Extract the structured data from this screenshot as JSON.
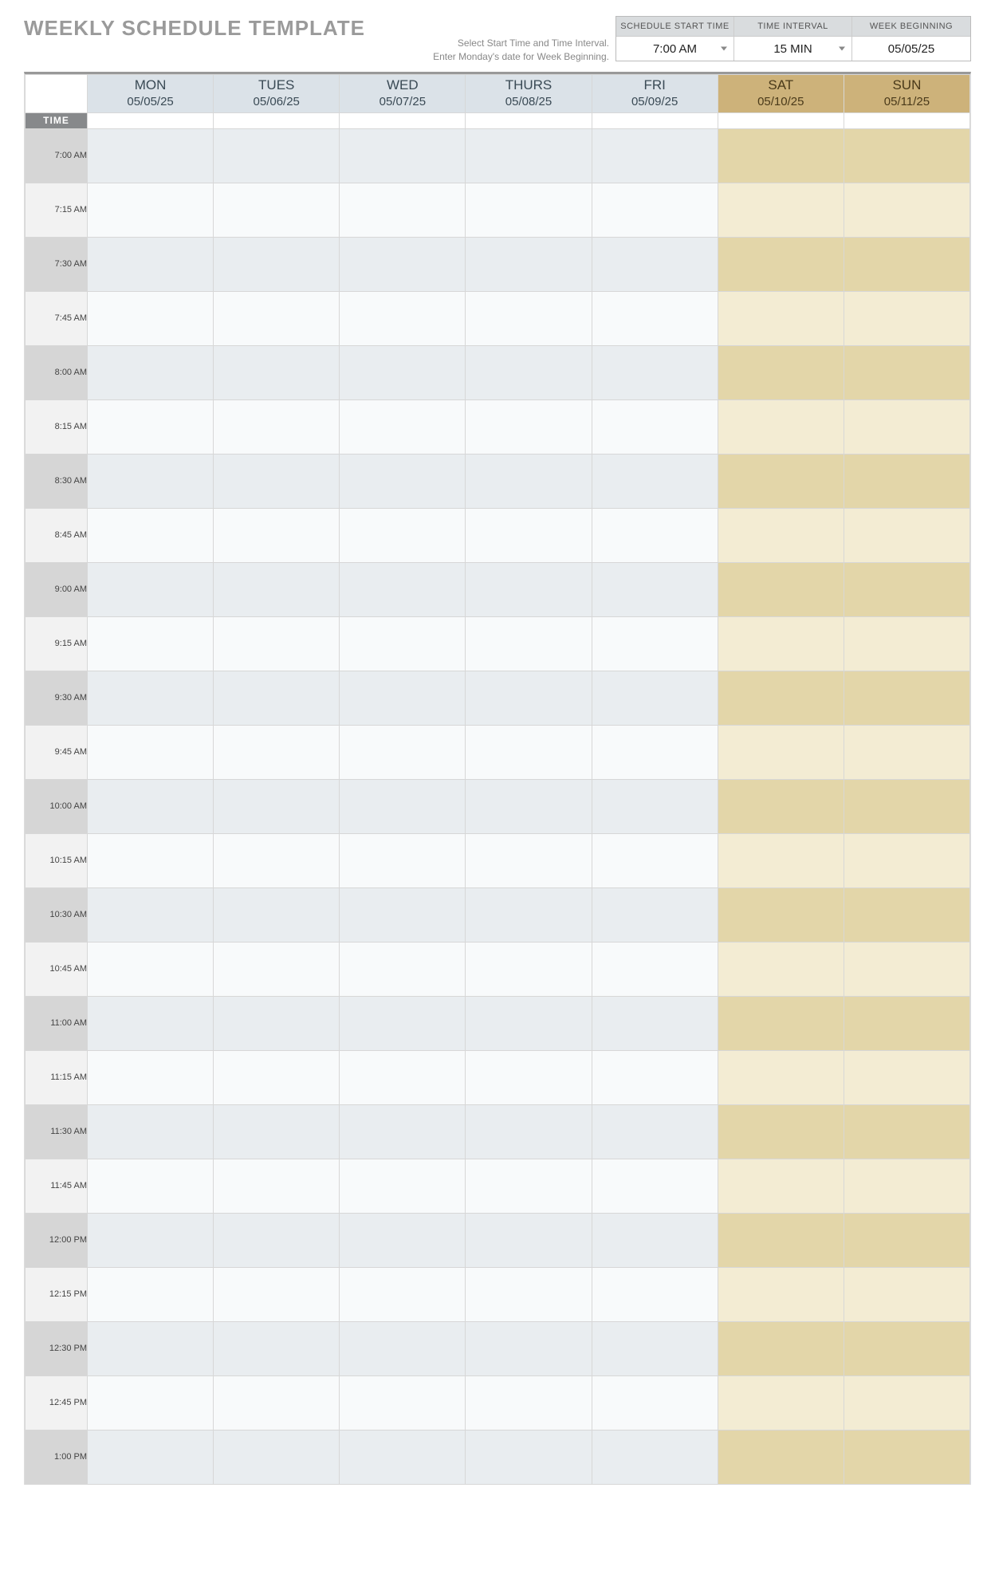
{
  "title": "WEEKLY SCHEDULE TEMPLATE",
  "help": {
    "line1": "Select Start Time and Time Interval.",
    "line2": "Enter Monday's date for Week Beginning."
  },
  "controls": {
    "start_time": {
      "label": "SCHEDULE START TIME",
      "value": "7:00 AM"
    },
    "interval": {
      "label": "TIME INTERVAL",
      "value": "15 MIN"
    },
    "week_begin": {
      "label": "WEEK BEGINNING",
      "value": "05/05/25"
    }
  },
  "time_header": "TIME",
  "days": [
    {
      "name": "MON",
      "date": "05/05/25",
      "weekend": false
    },
    {
      "name": "TUES",
      "date": "05/06/25",
      "weekend": false
    },
    {
      "name": "WED",
      "date": "05/07/25",
      "weekend": false
    },
    {
      "name": "THURS",
      "date": "05/08/25",
      "weekend": false
    },
    {
      "name": "FRI",
      "date": "05/09/25",
      "weekend": false
    },
    {
      "name": "SAT",
      "date": "05/10/25",
      "weekend": true
    },
    {
      "name": "SUN",
      "date": "05/11/25",
      "weekend": true
    }
  ],
  "times": [
    "7:00 AM",
    "7:15 AM",
    "7:30 AM",
    "7:45 AM",
    "8:00 AM",
    "8:15 AM",
    "8:30 AM",
    "8:45 AM",
    "9:00 AM",
    "9:15 AM",
    "9:30 AM",
    "9:45 AM",
    "10:00 AM",
    "10:15 AM",
    "10:30 AM",
    "10:45 AM",
    "11:00 AM",
    "11:15 AM",
    "11:30 AM",
    "11:45 AM",
    "12:00 PM",
    "12:15 PM",
    "12:30 PM",
    "12:45 PM",
    "1:00 PM"
  ]
}
